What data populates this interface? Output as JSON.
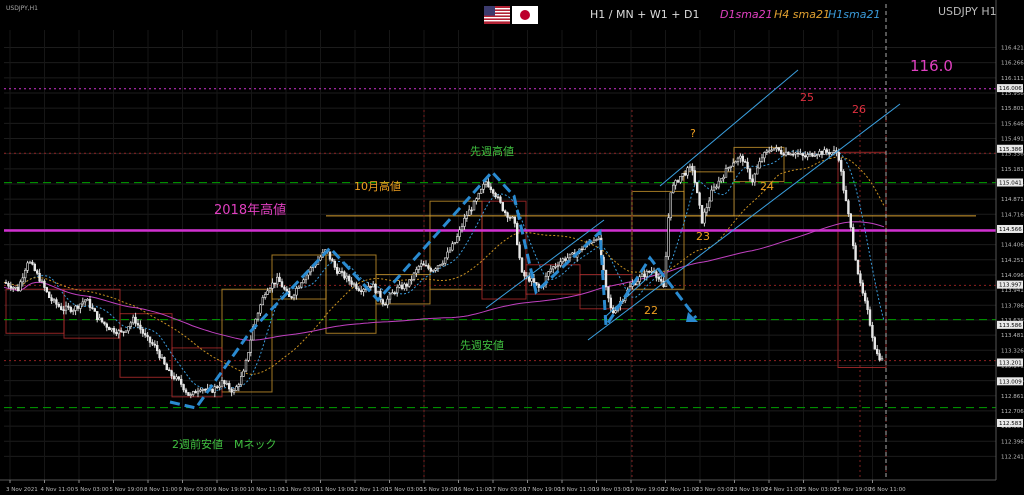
{
  "window": {
    "corner_label": "USDJPY,H1",
    "symbol": "USDJPY H1",
    "timeframes": "H1 / MN + W1 + D1",
    "legend": [
      {
        "text": "D1sma21",
        "color": "#e040c0"
      },
      {
        "text": "H4 sma21",
        "color": "#e0a030"
      },
      {
        "text": "H1sma21",
        "color": "#3a9ad9"
      }
    ],
    "flags": [
      "us-flag-icon",
      "japan-flag-icon"
    ]
  },
  "colors": {
    "bg": "#000000",
    "candle_up": "#e8e8e8",
    "candle_down": "#e8e8e8",
    "magenta_line": "#d030d0",
    "green_dash": "#00a000",
    "h1_sma": "#3a9ad9",
    "h4_sma": "#c89020",
    "d1_sma": "#c040c0",
    "box_orange": "#d8a030",
    "box_red": "#c03030",
    "channel": "#3aa0e0",
    "annotation_green": "#40c040",
    "annotation_orange": "#f0a020",
    "annotation_magenta": "#e040c0",
    "annotation_red": "#e03040"
  },
  "annotations": {
    "price_116": "116.0",
    "high_2018": "2018年高値",
    "oct_high": "10月高値",
    "last_week_high": "先週高値",
    "last_week_low": "先週安値",
    "two_weeks_low": "2週前安値　Mネック",
    "question": "?",
    "day_22": "22",
    "day_23": "23",
    "day_24": "24",
    "day_25": "25",
    "day_26": "26"
  },
  "chart_data": {
    "type": "candlestick",
    "symbol": "USDJPY",
    "timeframe": "H1",
    "ylim": [
      112.0,
      116.6
    ],
    "price_axis_labels": [
      "116.421",
      "116.266",
      "116.111",
      "115.956",
      "115.801",
      "115.646",
      "115.491",
      "115.336",
      "115.181",
      "115.026",
      "114.871",
      "114.716",
      "114.561",
      "114.406",
      "114.251",
      "114.096",
      "113.941",
      "113.786",
      "113.636",
      "113.481",
      "113.326",
      "113.171",
      "113.016",
      "112.861",
      "112.706",
      "112.551",
      "112.396",
      "112.241"
    ],
    "price_axis_tags": [
      {
        "value": 116.006,
        "label": "116.006"
      },
      {
        "value": 115.386,
        "label": "115.386"
      },
      {
        "value": 115.041,
        "label": "115.041"
      },
      {
        "value": 114.566,
        "label": "114.566"
      },
      {
        "value": 113.997,
        "label": "113.997"
      },
      {
        "value": 113.586,
        "label": "113.586"
      },
      {
        "value": 113.201,
        "label": "113.201"
      },
      {
        "value": 113.009,
        "label": "113.009"
      },
      {
        "value": 112.583,
        "label": "112.583"
      }
    ],
    "time_axis_labels": [
      "3 Nov 2021",
      "4 Nov 11:00",
      "5 Nov 03:00",
      "5 Nov 19:00",
      "8 Nov 11:00",
      "9 Nov 03:00",
      "9 Nov 19:00",
      "10 Nov 11:00",
      "11 Nov 03:00",
      "11 Nov 19:00",
      "12 Nov 11:00",
      "15 Nov 03:00",
      "15 Nov 19:00",
      "16 Nov 11:00",
      "17 Nov 03:00",
      "17 Nov 19:00",
      "18 Nov 11:00",
      "19 Nov 03:00",
      "19 Nov 19:00",
      "22 Nov 11:00",
      "23 Nov 03:00",
      "23 Nov 19:00",
      "24 Nov 11:00",
      "25 Nov 03:00",
      "25 Nov 19:00",
      "26 Nov 11:00"
    ],
    "horizontal_levels": {
      "round_116": 116.0,
      "high_2018": 114.55,
      "oct_high": 114.7,
      "last_week_high": 115.04,
      "last_week_low": 113.64,
      "two_weeks_low": 112.74,
      "red_dotted": [
        115.34,
        113.99,
        113.22
      ]
    },
    "close_path": [
      [
        0,
        114.02
      ],
      [
        14,
        113.95
      ],
      [
        24,
        114.25
      ],
      [
        36,
        114.05
      ],
      [
        46,
        113.85
      ],
      [
        58,
        113.75
      ],
      [
        70,
        113.75
      ],
      [
        82,
        113.85
      ],
      [
        94,
        113.65
      ],
      [
        106,
        113.55
      ],
      [
        118,
        113.5
      ],
      [
        130,
        113.65
      ],
      [
        142,
        113.45
      ],
      [
        152,
        113.35
      ],
      [
        164,
        113.1
      ],
      [
        176,
        113.0
      ],
      [
        186,
        112.85
      ],
      [
        196,
        112.95
      ],
      [
        206,
        112.9
      ],
      [
        218,
        113.0
      ],
      [
        230,
        112.9
      ],
      [
        240,
        113.1
      ],
      [
        250,
        113.6
      ],
      [
        262,
        113.95
      ],
      [
        274,
        114.05
      ],
      [
        286,
        113.85
      ],
      [
        298,
        114.05
      ],
      [
        310,
        114.2
      ],
      [
        322,
        114.35
      ],
      [
        332,
        114.15
      ],
      [
        344,
        114.05
      ],
      [
        356,
        113.95
      ],
      [
        368,
        114.0
      ],
      [
        380,
        113.8
      ],
      [
        392,
        113.95
      ],
      [
        404,
        114.0
      ],
      [
        416,
        114.2
      ],
      [
        428,
        114.15
      ],
      [
        440,
        114.25
      ],
      [
        452,
        114.45
      ],
      [
        462,
        114.7
      ],
      [
        472,
        114.85
      ],
      [
        482,
        115.05
      ],
      [
        490,
        114.95
      ],
      [
        500,
        114.75
      ],
      [
        510,
        114.65
      ],
      [
        518,
        114.1
      ],
      [
        526,
        114.05
      ],
      [
        536,
        113.95
      ],
      [
        546,
        114.15
      ],
      [
        558,
        114.25
      ],
      [
        570,
        114.3
      ],
      [
        582,
        114.4
      ],
      [
        594,
        114.5
      ],
      [
        602,
        113.95
      ],
      [
        608,
        113.7
      ],
      [
        618,
        113.85
      ],
      [
        628,
        114.0
      ],
      [
        640,
        114.1
      ],
      [
        650,
        114.15
      ],
      [
        660,
        113.95
      ],
      [
        666,
        114.95
      ],
      [
        676,
        115.1
      ],
      [
        688,
        115.2
      ],
      [
        698,
        114.65
      ],
      [
        708,
        114.95
      ],
      [
        718,
        115.1
      ],
      [
        728,
        115.25
      ],
      [
        738,
        115.3
      ],
      [
        748,
        115.05
      ],
      [
        758,
        115.3
      ],
      [
        768,
        115.4
      ],
      [
        778,
        115.35
      ],
      [
        790,
        115.35
      ],
      [
        800,
        115.3
      ],
      [
        812,
        115.35
      ],
      [
        824,
        115.35
      ],
      [
        834,
        115.35
      ],
      [
        840,
        114.95
      ],
      [
        848,
        114.5
      ],
      [
        856,
        114.0
      ],
      [
        864,
        113.7
      ],
      [
        872,
        113.3
      ],
      [
        880,
        113.2
      ]
    ]
  }
}
